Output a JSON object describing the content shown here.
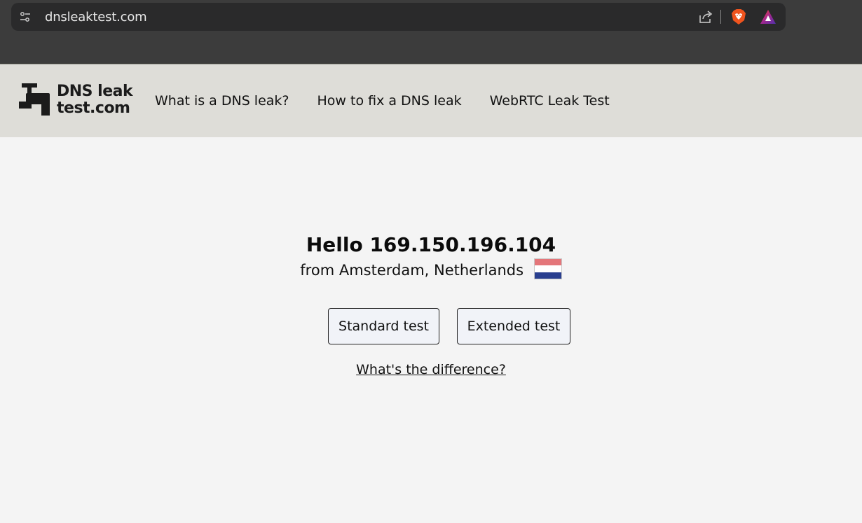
{
  "browser": {
    "url": "dnsleaktest.com",
    "icons": [
      "site-settings-icon",
      "share-icon",
      "brave-shields-icon",
      "brave-rewards-icon"
    ]
  },
  "header": {
    "logo_line1": "DNS leak",
    "logo_line2": "test.com",
    "nav": [
      {
        "label": "What is a DNS leak?"
      },
      {
        "label": "How to fix a DNS leak"
      },
      {
        "label": "WebRTC Leak Test"
      }
    ]
  },
  "main": {
    "greeting": "Hello 169.150.196.104",
    "location": "from Amsterdam, Netherlands",
    "flag": {
      "country": "Netherlands",
      "colors": [
        "#e4767a",
        "#ffffff",
        "#2a3f8f"
      ]
    },
    "buttons": {
      "standard": "Standard test",
      "extended": "Extended test"
    },
    "difference_link": "What's the difference?"
  },
  "colors": {
    "chrome_bg": "#3c3c3c",
    "addressbar_bg": "#2a2a2b",
    "header_bg": "#deddd8",
    "page_bg": "#f4f4f4",
    "button_bg": "#f1f3f8"
  }
}
